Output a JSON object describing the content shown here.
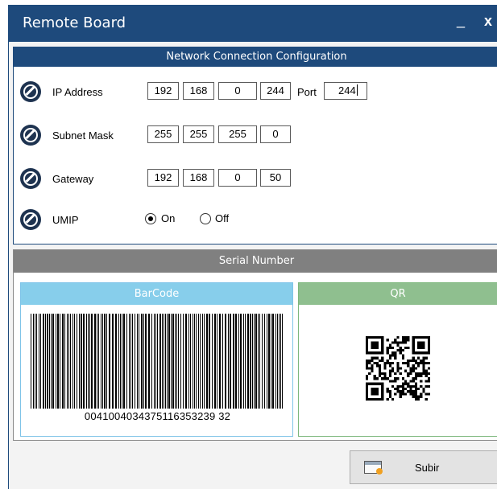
{
  "window": {
    "title": "Remote Board",
    "minimize_glyph": "_",
    "close_glyph": "x"
  },
  "network": {
    "header": "Network Connection Configuration",
    "ip": {
      "label": "IP Address",
      "octets": [
        "192",
        "168",
        "0",
        "244"
      ],
      "port_label": "Port",
      "port": "244"
    },
    "subnet": {
      "label": "Subnet Mask",
      "octets": [
        "255",
        "255",
        "255",
        "0"
      ]
    },
    "gateway": {
      "label": "Gateway",
      "octets": [
        "192",
        "168",
        "0",
        "50"
      ]
    },
    "umip": {
      "label": "UMIP",
      "on_label": "On",
      "off_label": "Off",
      "selected": "On"
    },
    "row_icon": "edit-circle-icon"
  },
  "serial": {
    "header": "Serial Number",
    "barcode_header": "BarCode",
    "barcode_value": "0041004034375116353239 32",
    "qr_header": "QR"
  },
  "actions": {
    "upload_label": "Subir",
    "upload_icon": "window-icon"
  },
  "colors": {
    "primary": "#1e4a7c",
    "serial_header": "#808080",
    "barcode_header": "#87ceeb",
    "qr_header": "#8fbf8f"
  }
}
